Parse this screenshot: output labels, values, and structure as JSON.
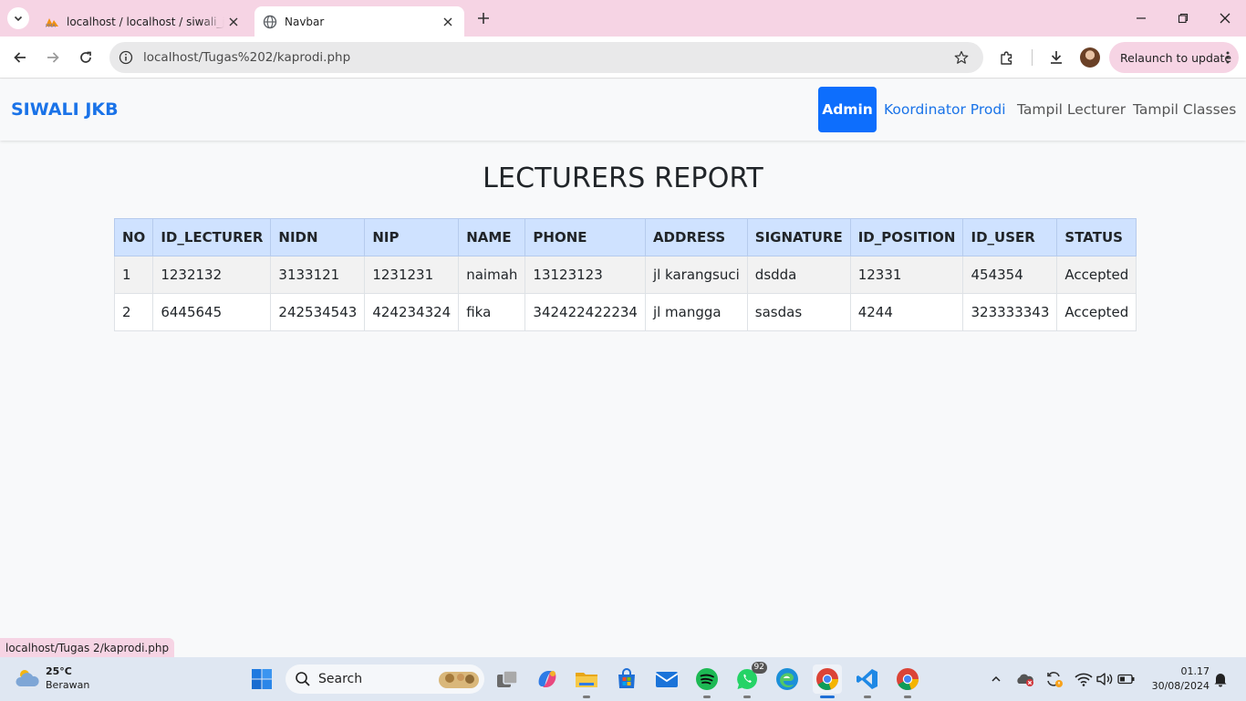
{
  "browser": {
    "tabs": [
      {
        "title": "localhost / localhost / siwali_jkb",
        "active": false,
        "icon": "phpmyadmin-icon"
      },
      {
        "title": "Navbar",
        "active": true,
        "icon": "globe-icon"
      }
    ],
    "url": "localhost/Tugas%202/kaprodi.php",
    "relaunch_label": "Relaunch to update",
    "status_url": "localhost/Tugas 2/kaprodi.php"
  },
  "navbar": {
    "brand": "SIWALI JKB",
    "links": [
      {
        "label": "Admin",
        "active": true
      },
      {
        "label": "Koordinator Prodi",
        "active": false
      },
      {
        "label": "Tampil Lecturer",
        "active": false
      },
      {
        "label": "Tampil Classes",
        "active": false
      }
    ]
  },
  "report": {
    "title": "LECTURERS REPORT",
    "columns": [
      "NO",
      "ID_LECTURER",
      "NIDN",
      "NIP",
      "NAME",
      "PHONE",
      "ADDRESS",
      "SIGNATURE",
      "ID_POSITION",
      "ID_USER",
      "STATUS"
    ],
    "rows": [
      [
        "1",
        "1232132",
        "3133121",
        "1231231",
        "naimah",
        "13123123",
        "jl karangsuci",
        "dsdda",
        "12331",
        "454354",
        "Accepted"
      ],
      [
        "2",
        "6445645",
        "242534543",
        "424234324",
        "fika",
        "342422422234",
        "jl mangga",
        "sasdas",
        "4244",
        "323333343",
        "Accepted"
      ]
    ]
  },
  "taskbar": {
    "weather_temp": "25°C",
    "weather_desc": "Berawan",
    "search_label": "Search",
    "whatsapp_badge": "92",
    "time": "01.17",
    "date": "30/08/2024"
  },
  "colors": {
    "tabbar": "#f6d4e4",
    "brand": "#1a73e8",
    "admin_button": "#0d6efd",
    "table_header": "#cfe2ff"
  }
}
